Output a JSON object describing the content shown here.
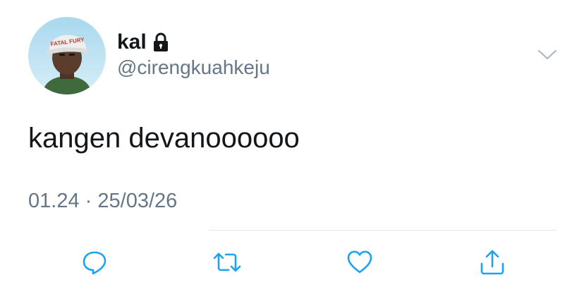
{
  "user": {
    "display_name": "kal",
    "handle": "@cirengkuahkeju",
    "cap_text": "FATAL FURY",
    "protected_icon": "lock-icon"
  },
  "tweet": {
    "text": "kangen devanoooooo",
    "time": "01.24",
    "separator": "·",
    "date": "25/03/26"
  },
  "actions": {
    "reply_icon": "reply-icon",
    "retweet_icon": "retweet-icon",
    "like_icon": "heart-icon",
    "share_icon": "share-icon",
    "menu_icon": "chevron-down-icon"
  },
  "colors": {
    "text": "#14171a",
    "secondary": "#657786",
    "icon": "#1da1f2",
    "divider": "#e1e8ed"
  }
}
